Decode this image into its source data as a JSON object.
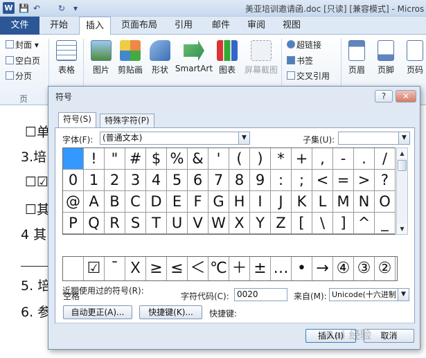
{
  "window": {
    "title": "美亚培训邀请函.doc [只读] [兼容模式] - Micros",
    "app_icon": "W"
  },
  "quick_access": {
    "save": "💾",
    "undo": "↶",
    "redo": "↻",
    "customize": "▾"
  },
  "ribbon": {
    "file_tab": "文件",
    "tabs": [
      "开始",
      "插入",
      "页面布局",
      "引用",
      "邮件",
      "审阅",
      "视图"
    ],
    "pages_group": {
      "cover": "封面",
      "blank": "空白页",
      "page_break": "分页",
      "label": "页"
    },
    "buttons": {
      "table": "表格",
      "picture": "图片",
      "clipart": "剪贴画",
      "shapes": "形状",
      "smartart": "SmartArt",
      "chart": "图表",
      "screenshot": "屏幕截图",
      "hyperlink": "超链接",
      "bookmark": "书签",
      "crossref": "交叉引用",
      "header": "页眉",
      "footer": "页脚",
      "pagenum": "页码"
    }
  },
  "document": {
    "lines": [
      "☐单",
      "3.培",
      "☐☑",
      "☐其",
      "4 其",
      "5. 培",
      "6. 参"
    ]
  },
  "dialog": {
    "title": "符号",
    "help": "?",
    "close": "✕",
    "tab_symbols": "符号(S)",
    "tab_special": "特殊字符(P)",
    "font_label": "字体(F):",
    "font_value": "(普通文本)",
    "subset_label": "子集(U):",
    "subset_value": "",
    "symbols": [
      " ",
      "!",
      "\"",
      "#",
      "$",
      "%",
      "&",
      "'",
      "(",
      ")",
      "*",
      "+",
      ",",
      "-",
      ".",
      "/",
      "0",
      "1",
      "2",
      "3",
      "4",
      "5",
      "6",
      "7",
      "8",
      "9",
      ":",
      ";",
      "<",
      "=",
      ">",
      "?",
      "@",
      "A",
      "B",
      "C",
      "D",
      "E",
      "F",
      "G",
      "H",
      "I",
      "J",
      "K",
      "L",
      "M",
      "N",
      "O",
      "P",
      "Q",
      "R",
      "S",
      "T",
      "U",
      "V",
      "W",
      "X",
      "Y",
      "Z",
      "[",
      "\\",
      "]",
      "^",
      "_"
    ],
    "recent_label": "近期使用过的符号(R):",
    "recent": [
      "",
      "☑",
      "¯",
      "Ｘ",
      "≥",
      "≤",
      "＜",
      "℃",
      "＋",
      "±",
      "…",
      "•",
      "→",
      "④",
      "③",
      "②"
    ],
    "char_name": "空格",
    "char_code_label": "字符代码(C):",
    "char_code_value": "0020",
    "from_label": "来自(M):",
    "from_value": "Unicode(十六进制",
    "autocorrect_btn": "自动更正(A)...",
    "shortcut_btn": "快捷键(K)...",
    "shortcut_label": "快捷键:",
    "insert_btn": "插入(I)",
    "cancel_btn": "取消"
  },
  "watermark": "Bai 经验"
}
